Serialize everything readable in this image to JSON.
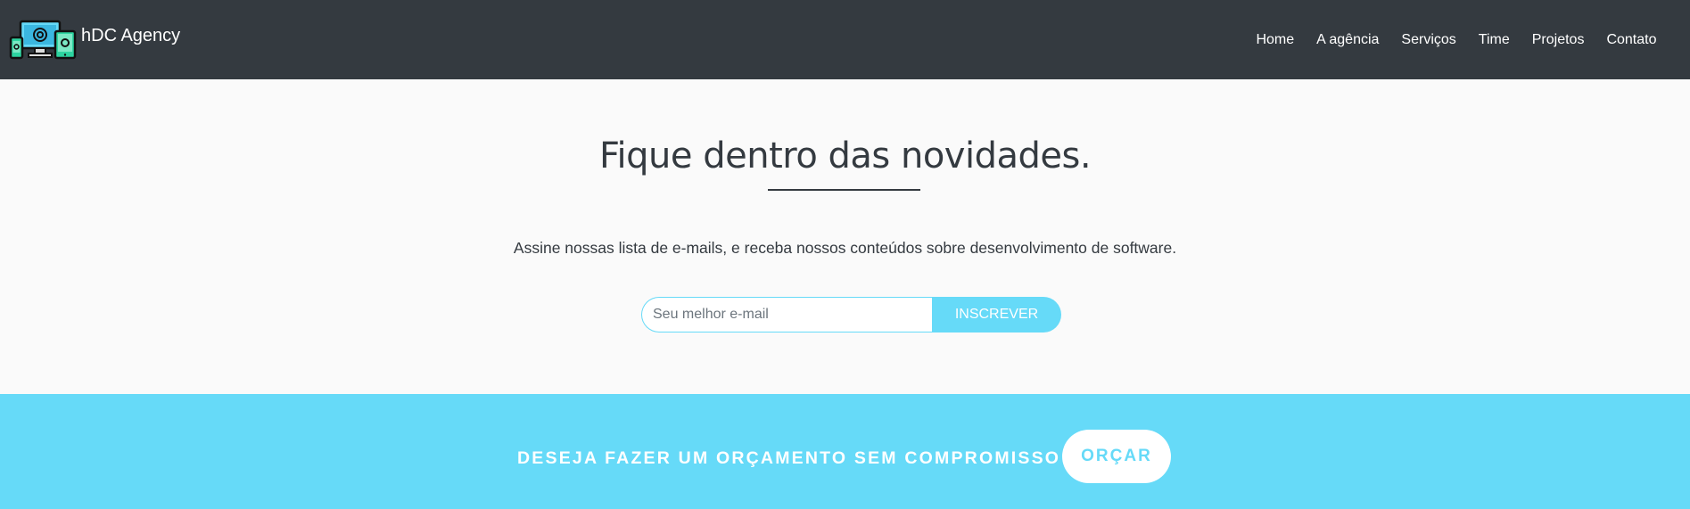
{
  "navbar": {
    "brand_name": "hDC Agency",
    "logo_icon": "devices-logo-icon",
    "links": [
      "Home",
      "A agência",
      "Serviços",
      "Time",
      "Projetos",
      "Contato"
    ]
  },
  "newsletter": {
    "title": "Fique dentro das novidades.",
    "text": "Assine nossas lista de e-mails, e receba nossos conteúdos sobre desenvolvimento de software.",
    "email_placeholder": "Seu melhor e-mail",
    "email_value": "",
    "subscribe_label": "INSCREVER"
  },
  "cta": {
    "text": "DESEJA FAZER UM ORÇAMENTO SEM COMPROMISSO",
    "button_label": "ORÇAR"
  },
  "colors": {
    "navbar_bg": "#343a40",
    "accent": "#66daf8",
    "page_bg": "#fafafa",
    "text_dark": "#343a40"
  }
}
